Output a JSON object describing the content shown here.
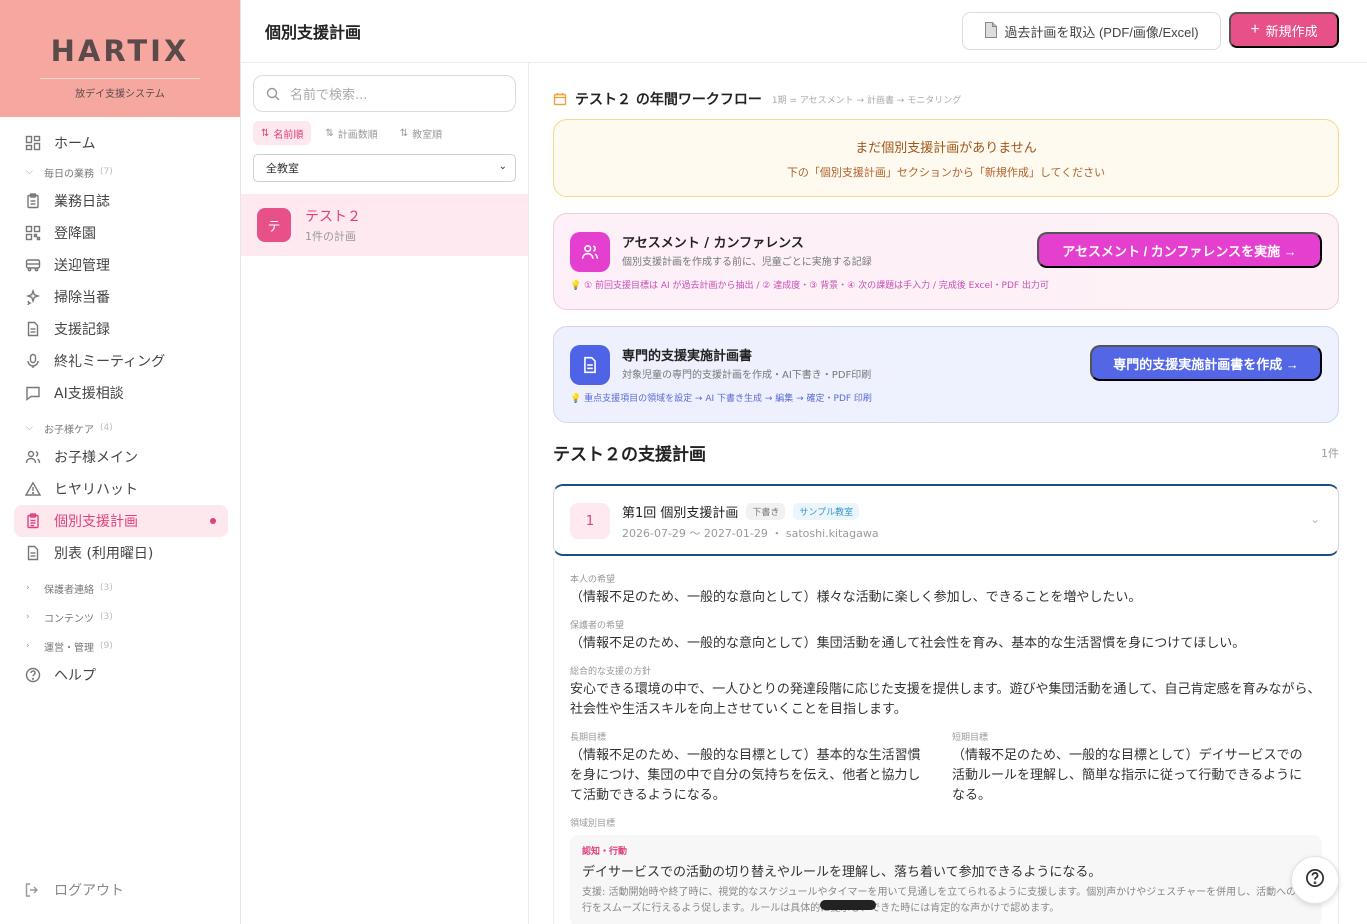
{
  "brand": {
    "logo": "HARTIX",
    "subtitle": "放デイ支援システム"
  },
  "nav": {
    "home": "ホーム",
    "group_daily": {
      "label": "毎日の業務",
      "count": "(7)"
    },
    "daily": [
      "業務日誌",
      "登降園",
      "送迎管理",
      "掃除当番",
      "支援記録",
      "終礼ミーティング",
      "AI支援相談"
    ],
    "group_child": {
      "label": "お子様ケア",
      "count": "(4)"
    },
    "child": [
      "お子様メイン",
      "ヒヤリハット",
      "個別支援計画",
      "別表 (利用曜日)"
    ],
    "group_parent": {
      "label": "保護者連絡",
      "count": "(3)"
    },
    "group_content": {
      "label": "コンテンツ",
      "count": "(3)"
    },
    "group_admin": {
      "label": "運営・管理",
      "count": "(9)"
    },
    "help": "ヘルプ",
    "logout": "ログアウト"
  },
  "header": {
    "title": "個別支援計画",
    "import_label": "過去計画を取込 (PDF/画像/Excel)",
    "new_label": "新規作成"
  },
  "list": {
    "search_placeholder": "名前で検索...",
    "sorts": [
      "名前順",
      "計画数順",
      "教室順"
    ],
    "room_select": "全教室",
    "items": [
      {
        "avatar": "テ",
        "name": "テスト２",
        "sub": "1件の計画"
      }
    ]
  },
  "main": {
    "workflow_title": "テスト２ の年間ワークフロー",
    "workflow_sub": "1期 = アセスメント → 計画書 → モニタリング",
    "alert_title": "まだ個別支援計画がありません",
    "alert_sub": "下の「個別支援計画」セクションから「新規作成」してください",
    "assessment": {
      "title": "アセスメント / カンファレンス",
      "desc": "個別支援計画を作成する前に、児童ごとに実施する記録",
      "hint": "💡 ① 前回支援目標は AI が過去計画から抽出 / ② 達成度・③ 背景・④ 次の課題は手入力 / 完成後 Excel・PDF 出力可",
      "button": "アセスメント / カンファレンスを実施 →"
    },
    "specialist": {
      "title": "専門的支援実施計画書",
      "desc": "対象児童の専門的支援計画を作成・AI下書き・PDF印刷",
      "hint": "💡 重点支援項目の領域を設定 → AI 下書き生成 → 編集 → 確定・PDF 印刷",
      "button": "専門的支援実施計画書を作成 →"
    },
    "section_title": "テスト２の支援計画",
    "section_count": "1件",
    "plan": {
      "number": "1",
      "title": "第1回 個別支援計画",
      "badge_draft": "下書き",
      "badge_room": "サンプル教室",
      "period": "2026-07-29 〜 2027-01-29",
      "author": "satoshi.kitagawa"
    },
    "detail": {
      "wish_self_label": "本人の希望",
      "wish_self": "（情報不足のため、一般的な意向として）様々な活動に楽しく参加し、できることを増やしたい。",
      "wish_guardian_label": "保護者の希望",
      "wish_guardian": "（情報不足のため、一般的な意向として）集団活動を通して社会性を育み、基本的な生活習慣を身につけてほしい。",
      "policy_label": "総合的な支援の方針",
      "policy": "安心できる環境の中で、一人ひとりの発達段階に応じた支援を提供します。遊びや集団活動を通して、自己肯定感を育みながら、社会性や生活スキルを向上させていくことを目指します。",
      "long_goal_label": "長期目標",
      "long_goal": "（情報不足のため、一般的な目標として）基本的な生活習慣を身につけ、集団の中で自分の気持ちを伝え、他者と協力して活動できるようになる。",
      "short_goal_label": "短期目標",
      "short_goal": "（情報不足のため、一般的な目標として）デイサービスでの活動ルールを理解し、簡単な指示に従って行動できるようになる。",
      "domain_label": "領域別目標",
      "domain_tag": "認知・行動",
      "domain_goal": "デイサービスでの活動の切り替えやルールを理解し、落ち着いて参加できるようになる。",
      "domain_support": "支援: 活動開始時や終了時に、視覚的なスケジュールやタイマーを用いて見通しを立てられるように支援します。個別声かけやジェスチャーを併用し、活動への移行をスムーズに行えるよう促します。ルールは具体的に提示し、できた時には肯定的な声かけで認めます。"
    }
  },
  "colors": {
    "accent": "#e8508a",
    "brand_bg": "#f6a8a0",
    "assessment": "#e53fcf",
    "specialist": "#5266e6"
  }
}
